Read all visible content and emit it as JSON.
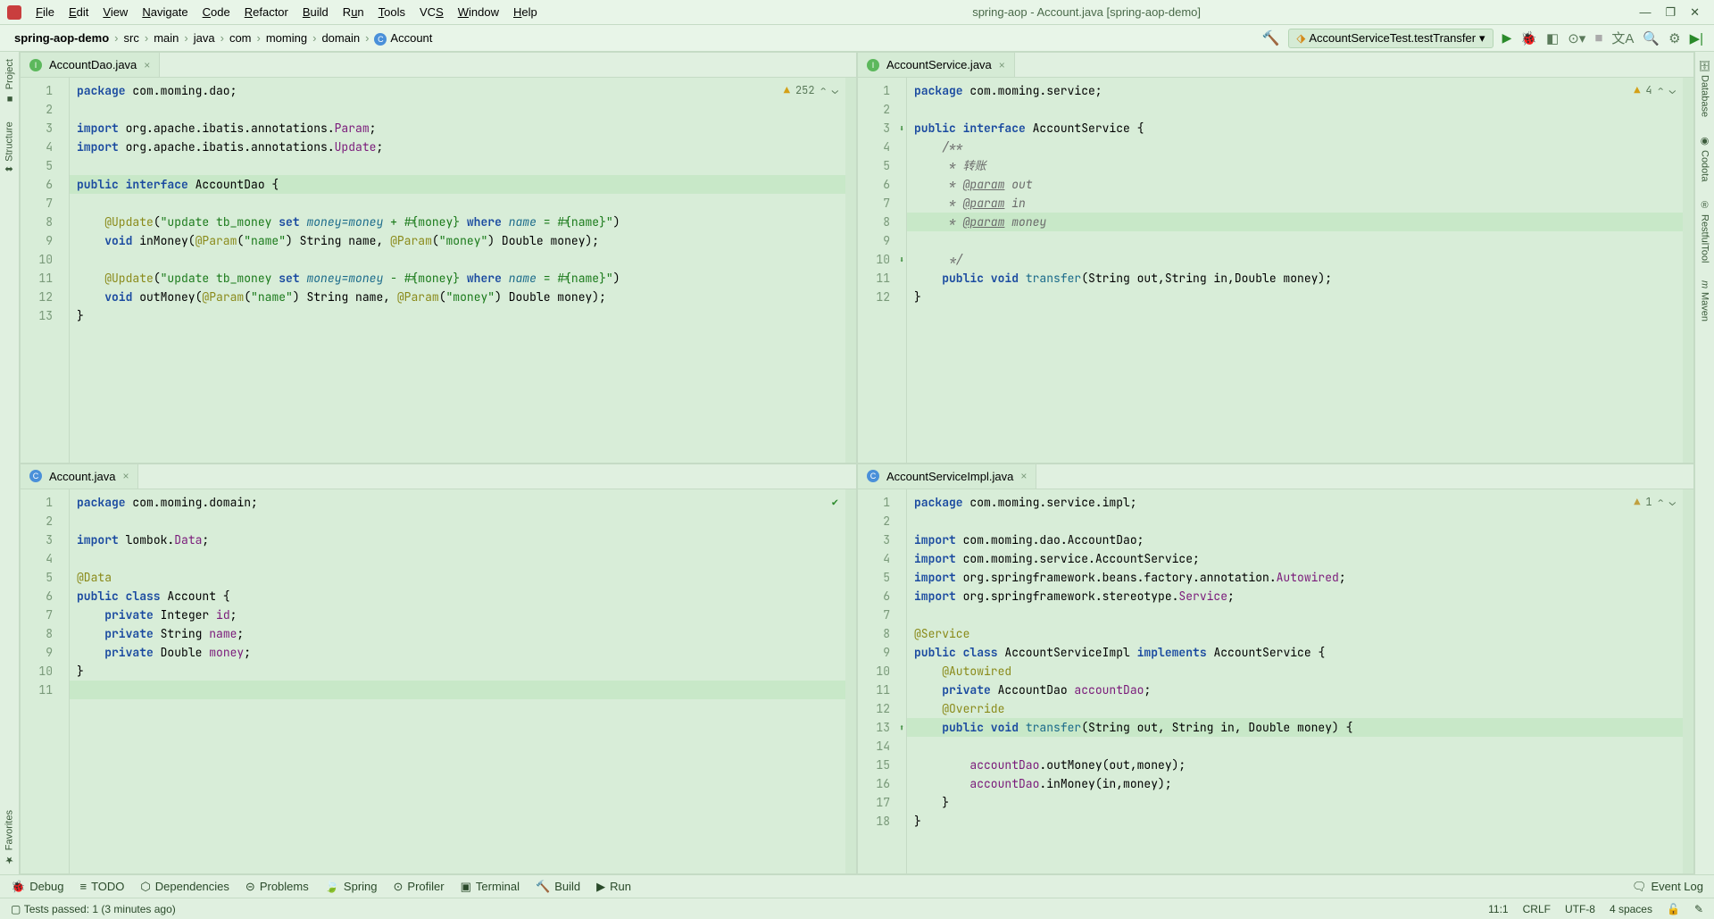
{
  "window": {
    "title": "spring-aop - Account.java [spring-aop-demo]"
  },
  "menu": {
    "file": "File",
    "edit": "Edit",
    "view": "View",
    "navigate": "Navigate",
    "code": "Code",
    "refactor": "Refactor",
    "build": "Build",
    "run": "Run",
    "tools": "Tools",
    "vcs": "VCS",
    "window": "Window",
    "help": "Help"
  },
  "breadcrumb": {
    "project": "spring-aop-demo",
    "src": "src",
    "main": "main",
    "java": "java",
    "com": "com",
    "moming": "moming",
    "domain": "domain",
    "class": "Account"
  },
  "run_config": "AccountServiceTest.testTransfer",
  "tabs": {
    "accountdao": "AccountDao.java",
    "account": "Account.java",
    "accountservice": "AccountService.java",
    "accountserviceimpl": "AccountServiceImpl.java"
  },
  "inspections": {
    "accountdao": "252",
    "accountservice": "4",
    "accountserviceimpl": "1"
  },
  "left_tools": {
    "project": "Project",
    "structure": "Structure",
    "favorites": "Favorites"
  },
  "right_tools": {
    "database": "Database",
    "codota": "Codota",
    "restful": "RestfulTool",
    "maven": "Maven"
  },
  "bottom": {
    "debug": "Debug",
    "todo": "TODO",
    "deps": "Dependencies",
    "problems": "Problems",
    "spring": "Spring",
    "profiler": "Profiler",
    "terminal": "Terminal",
    "build": "Build",
    "run": "Run",
    "eventlog": "Event Log"
  },
  "status": {
    "tests": "Tests passed: 1 (3 minutes ago)",
    "pos": "11:1",
    "crlf": "CRLF",
    "enc": "UTF-8",
    "indent": "4 spaces"
  },
  "code": {
    "accountdao": {
      "l1": "package com.moming.dao;",
      "l3a": "import org.apache.ibatis.annotations.",
      "l3b": "Param",
      "l3c": ";",
      "l4a": "import org.apache.ibatis.annotations.",
      "l4b": "Update",
      "l4c": ";",
      "l6": "public interface AccountDao {",
      "l7a": "@Update",
      "l7b": "(\"update tb_money set money=money + #{money} where name = #{name}\")",
      "l8a": "void inMoney(",
      "l8b": "@Param",
      "l8c": "(\"name\") String name, ",
      "l8d": "@Param",
      "l8e": "(\"money\") Double money);",
      "l10a": "@Update",
      "l10b": "(\"update tb_money set money=money - #{money} where name = #{name}\")",
      "l11a": "void outMoney(",
      "l11b": "@Param",
      "l11c": "(\"name\") String name, ",
      "l11d": "@Param",
      "l11e": "(\"money\") Double money);",
      "l12": "}"
    },
    "account": {
      "l1": "package com.moming.domain;",
      "l3a": "import lombok.",
      "l3b": "Data",
      "l3c": ";",
      "l5": "@Data",
      "l6": "public class Account {",
      "l7": "    private Integer id;",
      "l8": "    private String name;",
      "l9": "    private Double money;",
      "l10": "}"
    },
    "accountservice": {
      "l1": "package com.moming.service;",
      "l3": "public interface AccountService {",
      "l4": "    /**",
      "l5": "     * 转账",
      "l6a": "     * ",
      "l6b": "@param",
      "l6c": " out",
      "l7a": "     * ",
      "l7b": "@param",
      "l7c": " in",
      "l8a": "     * ",
      "l8b": "@param",
      "l8c": " money",
      "l9": "     */",
      "l10a": "    public void ",
      "l10b": "transfer",
      "l10c": "(String out,String in,Double money);",
      "l11": "}"
    },
    "accountserviceimpl": {
      "l1": "package com.moming.service.impl;",
      "l3": "import com.moming.dao.AccountDao;",
      "l4": "import com.moming.service.AccountService;",
      "l5a": "import org.springframework.beans.factory.annotation.",
      "l5b": "Autowired",
      "l5c": ";",
      "l6a": "import org.springframework.stereotype.",
      "l6b": "Service",
      "l6c": ";",
      "l8": "@Service",
      "l9": "public class AccountServiceImpl implements AccountService {",
      "l10": "    @Autowired",
      "l11a": "    private AccountDao ",
      "l11b": "accountDao",
      "l11c": ";",
      "l12": "    @Override",
      "l13a": "    public void ",
      "l13b": "transfer",
      "l13c": "(String out, String in, Double money) {",
      "l14a": "        ",
      "l14b": "accountDao",
      "l14c": ".outMoney(out,money);",
      "l15a": "        ",
      "l15b": "accountDao",
      "l15c": ".inMoney(in,money);",
      "l16": "    }",
      "l17": "}"
    }
  }
}
